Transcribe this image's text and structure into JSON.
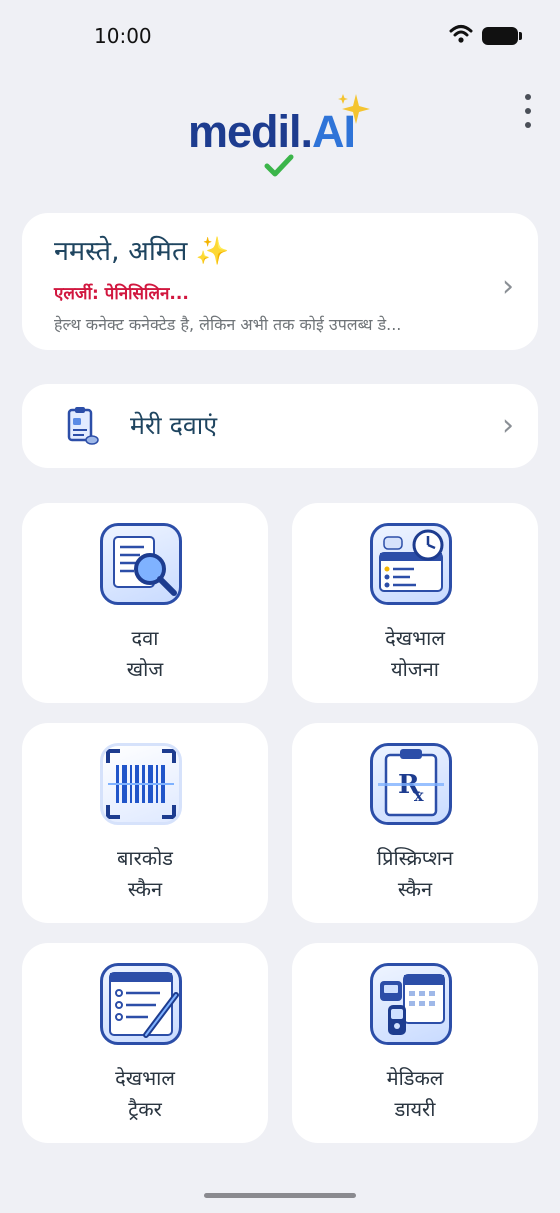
{
  "status_bar": {
    "time": "10:00"
  },
  "app": {
    "logo_main": "medil.",
    "logo_ai": "AI"
  },
  "greeting": {
    "title": "नमस्ते, अमित ✨",
    "allergy": "एलर्जी: पेनिसिलिन...",
    "health_status": "हेल्थ कनेक्ट कनेक्टेड है, लेकिन अभी तक कोई उपलब्ध डे..."
  },
  "my_meds": {
    "label": "मेरी दवाएं"
  },
  "tiles": [
    {
      "line1": "दवा",
      "line2": "खोज",
      "icon": "drug-search-icon"
    },
    {
      "line1": "देखभाल",
      "line2": "योजना",
      "icon": "care-plan-icon"
    },
    {
      "line1": "बारकोड",
      "line2": "स्कैन",
      "icon": "barcode-scan-icon"
    },
    {
      "line1": "प्रिस्क्रिप्शन",
      "line2": "स्कैन",
      "icon": "prescription-scan-icon"
    },
    {
      "line1": "देखभाल",
      "line2": "ट्रैकर",
      "icon": "care-tracker-icon"
    },
    {
      "line1": "मेडिकल",
      "line2": "डायरी",
      "icon": "medical-diary-icon"
    }
  ],
  "colors": {
    "accent": "#1d3c8f",
    "allergy": "#d1173f",
    "background": "#eff0f5"
  }
}
